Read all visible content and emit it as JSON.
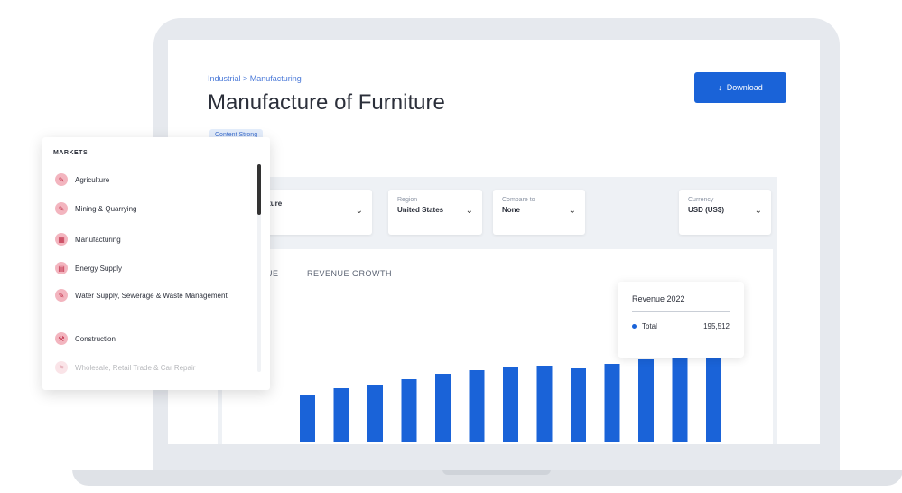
{
  "breadcrumb": "Industrial > Manufacturing",
  "title": "Manufacture of Furniture",
  "badge": "Content Strong",
  "download_label": "Download",
  "filters": [
    {
      "label": "",
      "value": "...ure of Furniture"
    },
    {
      "label": "Region",
      "value": "United States"
    },
    {
      "label": "Compare to",
      "value": "None"
    },
    {
      "label": "Currency",
      "value": "USD (US$)"
    }
  ],
  "tabs": [
    "...UE",
    "REVENUE GROWTH"
  ],
  "tooltip": {
    "title": "Revenue 2022",
    "series": "Total",
    "value": "195,512"
  },
  "markets": {
    "header": "MARKETS",
    "items": [
      "Agriculture",
      "Mining & Quarrying",
      "Manufacturing",
      "Energy Supply",
      "Water Supply, Sewerage & Waste Management",
      "Construction",
      "Wholesale, Retail Trade & Car Repair"
    ]
  },
  "chart_data": {
    "type": "bar",
    "values": [
      52,
      60,
      64,
      70,
      76,
      80,
      84,
      85,
      82,
      87,
      92,
      96,
      100
    ],
    "ylim": [
      0,
      100
    ]
  },
  "colors": {
    "accent": "#1a63d8",
    "market_icon": "#f3b5bf"
  }
}
